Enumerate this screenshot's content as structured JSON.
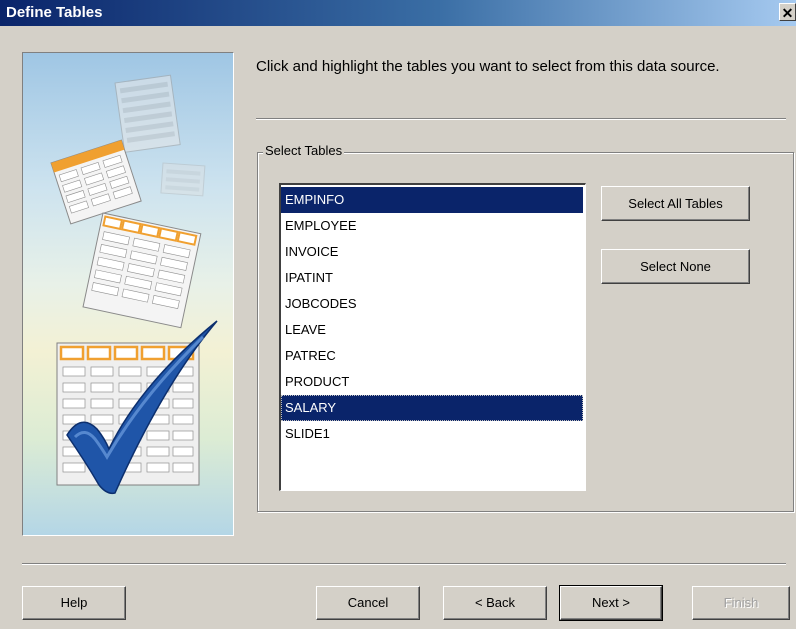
{
  "window": {
    "title": "Define Tables",
    "close_glyph": "✕"
  },
  "instructions": "Click and highlight the tables you want to select from this data source.",
  "select_tables": {
    "group_label": "Select Tables",
    "tables": [
      {
        "name": "EMPINFO",
        "selected": true
      },
      {
        "name": "EMPLOYEE",
        "selected": false
      },
      {
        "name": "INVOICE",
        "selected": false
      },
      {
        "name": "IPATINT",
        "selected": false
      },
      {
        "name": "JOBCODES",
        "selected": false
      },
      {
        "name": "LEAVE",
        "selected": false
      },
      {
        "name": "PATREC",
        "selected": false
      },
      {
        "name": "PRODUCT",
        "selected": false
      },
      {
        "name": "SALARY",
        "selected": true
      },
      {
        "name": "SLIDE1",
        "selected": false
      }
    ],
    "select_all_label": "Select All Tables",
    "select_none_label": "Select None"
  },
  "footer": {
    "help_label": "Help",
    "cancel_label": "Cancel",
    "back_label": "< Back",
    "next_label": "Next >",
    "finish_label": "Finish"
  },
  "colors": {
    "selection": "#0a246a",
    "face": "#d4d0c8",
    "title_gradient_start": "#0a246a",
    "title_gradient_end": "#a6caf0",
    "checkmark": "#1f55a8",
    "table_header": "#f0a030"
  },
  "icons": {
    "close": "close-icon",
    "illustration": "tables-with-checkmark-illustration"
  }
}
